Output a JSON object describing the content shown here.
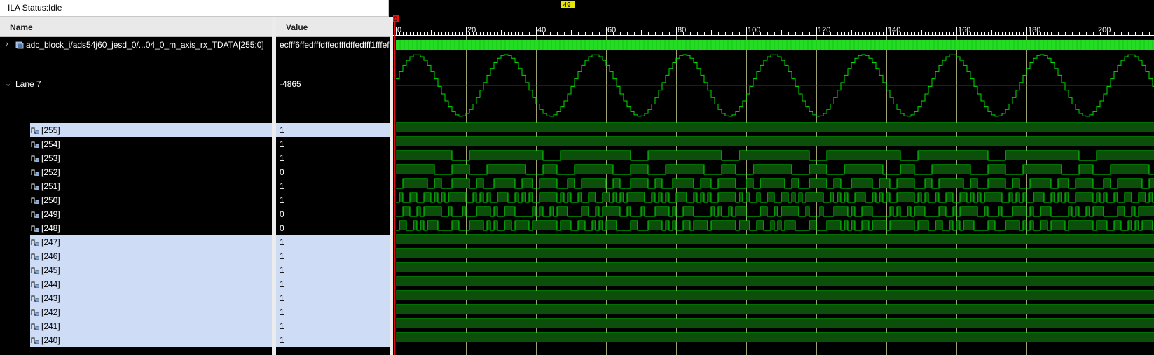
{
  "status": {
    "label": "ILA Status:",
    "value": "Idle"
  },
  "columns": {
    "name": "Name",
    "value": "Value"
  },
  "bus": {
    "name": "adc_block_i/ads54j60_jesd_0/...04_0_m_axis_rx_TDATA[255:0]",
    "value": "ecfff6ffedfffdffedfffdffedfff1fffef"
  },
  "lane": {
    "name": "Lane 7",
    "value": "-4865"
  },
  "bits": [
    {
      "name": "[255]",
      "value": "1",
      "selected": true
    },
    {
      "name": "[254]",
      "value": "1",
      "selected": false
    },
    {
      "name": "[253]",
      "value": "1",
      "selected": false
    },
    {
      "name": "[252]",
      "value": "0",
      "selected": false
    },
    {
      "name": "[251]",
      "value": "1",
      "selected": false
    },
    {
      "name": "[250]",
      "value": "1",
      "selected": false
    },
    {
      "name": "[249]",
      "value": "0",
      "selected": false
    },
    {
      "name": "[248]",
      "value": "0",
      "selected": false
    },
    {
      "name": "[247]",
      "value": "1",
      "selected": true
    },
    {
      "name": "[246]",
      "value": "1",
      "selected": true
    },
    {
      "name": "[245]",
      "value": "1",
      "selected": true
    },
    {
      "name": "[244]",
      "value": "1",
      "selected": true
    },
    {
      "name": "[243]",
      "value": "1",
      "selected": true
    },
    {
      "name": "[242]",
      "value": "1",
      "selected": true
    },
    {
      "name": "[241]",
      "value": "1",
      "selected": true
    },
    {
      "name": "[240]",
      "value": "1",
      "selected": true
    }
  ],
  "timeline": {
    "ticks": [
      "0",
      "20",
      "40",
      "60",
      "80",
      "100",
      "120",
      "140",
      "160",
      "180",
      "200"
    ],
    "cursor_label": "49",
    "trigger_label": "0",
    "cursor_sample": 49
  },
  "colors": {
    "wave": "#00e000",
    "wave_fill": "#0b4f0b",
    "bus_fill": "#22dd22",
    "cursor": "#e6e600",
    "grid": "#c8c890",
    "selection": "#cfdcf5"
  },
  "icons": {
    "expand": "chevron-right-icon",
    "collapse": "chevron-down-icon",
    "bus": "bus-icon",
    "bit": "signal-bit-icon"
  }
}
